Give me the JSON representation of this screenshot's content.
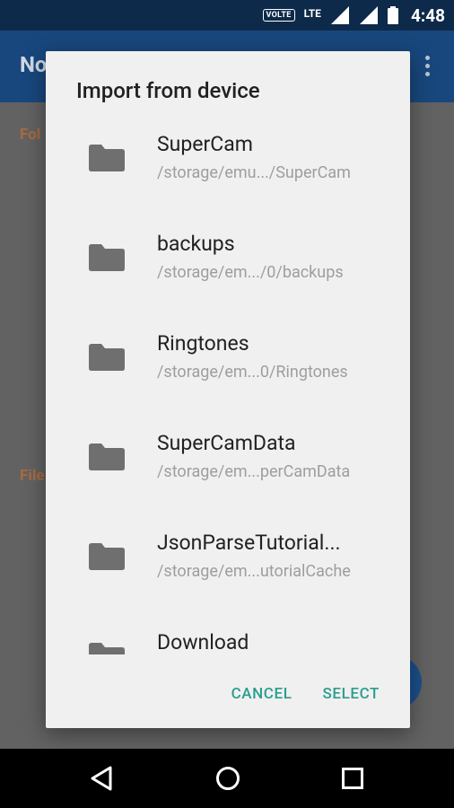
{
  "statusbar": {
    "volte": "VOLTE",
    "network": "LTE",
    "time": "4:48"
  },
  "app": {
    "title_partial": "No",
    "section_folders_partial": "Fol",
    "section_files_partial": "File"
  },
  "dialog": {
    "title": "Import from device",
    "items": [
      {
        "title": "SuperCam",
        "path": "/storage/emu.../SuperCam"
      },
      {
        "title": "backups",
        "path": "/storage/em.../0/backups"
      },
      {
        "title": "Ringtones",
        "path": "/storage/em...0/Ringtones"
      },
      {
        "title": "SuperCamData",
        "path": "/storage/em...perCamData"
      },
      {
        "title": "JsonParseTutorial...",
        "path": "/storage/em...utorialCache"
      },
      {
        "title": "Download",
        "path": ""
      }
    ],
    "cancel_label": "CANCEL",
    "select_label": "SELECT"
  },
  "colors": {
    "accent": "#2a9d8f",
    "appbar": "#18477d",
    "statusbar": "#0d2a4a"
  }
}
